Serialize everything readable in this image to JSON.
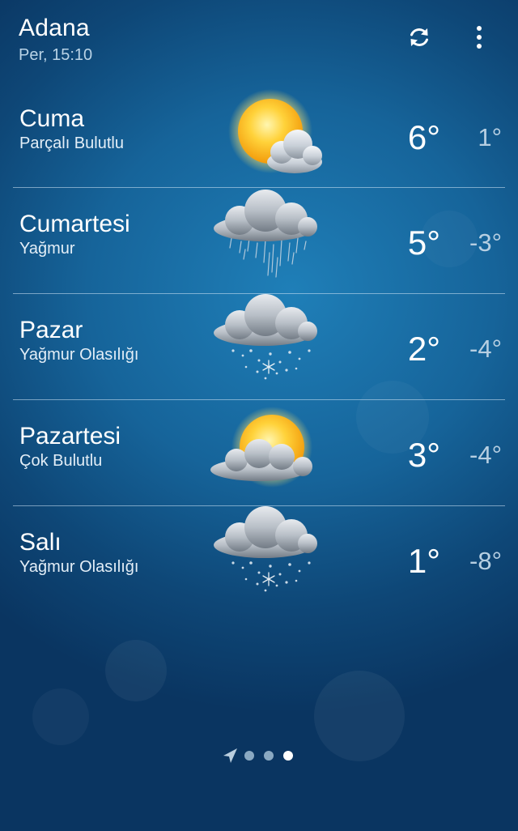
{
  "header": {
    "city": "Adana",
    "datetime": "Per, 15:10",
    "refresh_icon": "refresh-icon",
    "more_icon": "more-vert-icon"
  },
  "forecast": [
    {
      "day": "Cuma",
      "condition": "Parçalı Bulutlu",
      "high": "6°",
      "low": "1°",
      "icon": "partly-cloudy-icon"
    },
    {
      "day": "Cumartesi",
      "condition": "Yağmur",
      "high": "5°",
      "low": "-3°",
      "icon": "rain-icon"
    },
    {
      "day": "Pazar",
      "condition": "Yağmur Olasılığı",
      "high": "2°",
      "low": "-4°",
      "icon": "snow-icon"
    },
    {
      "day": "Pazartesi",
      "condition": "Çok Bulutlu",
      "high": "3°",
      "low": "-4°",
      "icon": "mostly-cloudy-icon"
    },
    {
      "day": "Salı",
      "condition": "Yağmur Olasılığı",
      "high": "1°",
      "low": "-8°",
      "icon": "snow-icon"
    }
  ],
  "pager": {
    "pages": 3,
    "active_page": 3,
    "location_icon": "location-arrow-icon"
  },
  "colors": {
    "background_top": "#1f7fb8",
    "background_edge": "#0a3561",
    "text_primary": "#ffffff",
    "text_low_temp": "#b7cfe2",
    "sun": "#ffc61a"
  }
}
